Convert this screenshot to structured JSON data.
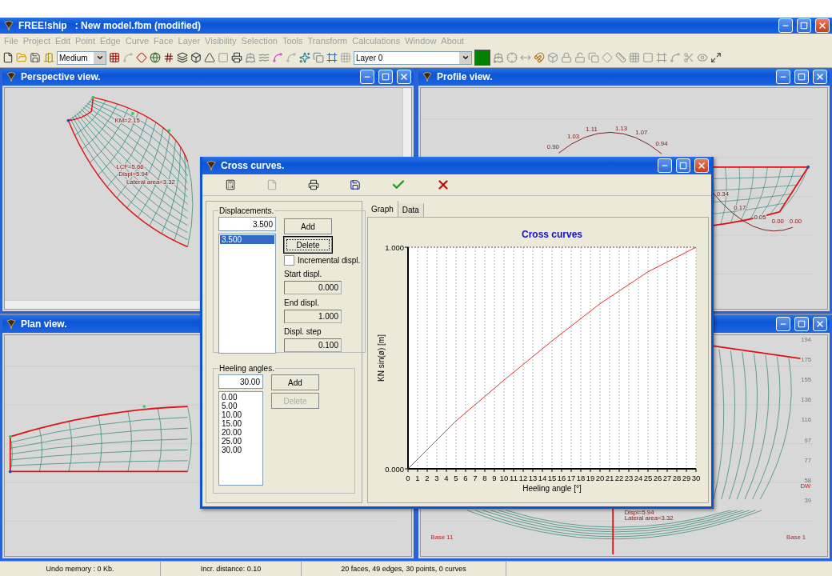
{
  "app": {
    "title": "FREE!ship   : New model.fbm (modified)"
  },
  "menu": [
    {
      "label": "File",
      "disabled": true
    },
    {
      "label": "Project",
      "disabled": true
    },
    {
      "label": "Edit",
      "disabled": true
    },
    {
      "label": "Point",
      "disabled": true
    },
    {
      "label": "Edge",
      "disabled": true
    },
    {
      "label": "Curve",
      "disabled": true
    },
    {
      "label": "Face",
      "disabled": true
    },
    {
      "label": "Layer",
      "disabled": true
    },
    {
      "label": "Visibility",
      "disabled": true
    },
    {
      "label": "Selection",
      "disabled": true
    },
    {
      "label": "Tools",
      "disabled": true
    },
    {
      "label": "Transform",
      "disabled": true
    },
    {
      "label": "Calculations",
      "disabled": true
    },
    {
      "label": "Window",
      "disabled": true
    },
    {
      "label": "About",
      "disabled": true
    }
  ],
  "toolbar": {
    "precision": "Medium",
    "layer": "Layer 0"
  },
  "views": [
    {
      "kind": "perspective",
      "title": "Perspective view.",
      "labels": [
        "KM=2.15",
        "LCF=5.66",
        "Displ=5.94",
        "Lateral area=3.32"
      ]
    },
    {
      "kind": "profile",
      "title": "Profile view.",
      "labels": [
        "0.90",
        "1.03",
        "1.11",
        "1.13",
        "1.07",
        "0.94",
        "0.34",
        "0.17",
        "0.05",
        "0.00",
        "0.00"
      ]
    },
    {
      "kind": "plan",
      "title": "Plan view."
    },
    {
      "kind": "bodyplan",
      "labels": [
        "Displ=5.94",
        "Lateral area=3.32",
        "Base 11",
        "Base 1",
        "DW"
      ],
      "scale": [
        "194",
        "175",
        "155",
        "136",
        "116",
        "97",
        "77",
        "58",
        "39"
      ]
    }
  ],
  "dialog": {
    "title": "Cross curves.",
    "displacements": {
      "title": "Displacements.",
      "input": "3.500",
      "add": {
        "label": "Add",
        "disabled": false,
        "focused": false
      },
      "delete": {
        "label": "Delete",
        "disabled": false,
        "focused": true
      },
      "items": [
        {
          "label": "3.500",
          "selected": true
        }
      ],
      "incremental": {
        "label": "Incremental displ.",
        "checked": false
      },
      "fields": [
        {
          "label": "Start displ.",
          "value": "0.000",
          "disabled": true
        },
        {
          "label": "End displ.",
          "value": "1.000",
          "disabled": true
        },
        {
          "label": "Displ. step",
          "value": "0.100",
          "disabled": true
        }
      ]
    },
    "heeling": {
      "title": "Heeling angles.",
      "input": "30.00",
      "add": {
        "label": "Add",
        "disabled": false,
        "focused": false
      },
      "delete": {
        "label": "Delete",
        "disabled": true,
        "focused": false
      },
      "items": [
        {
          "label": "0.00",
          "selected": false
        },
        {
          "label": "5.00",
          "selected": false
        },
        {
          "label": "10.00",
          "selected": false
        },
        {
          "label": "15.00",
          "selected": false
        },
        {
          "label": "20.00",
          "selected": false
        },
        {
          "label": "25.00",
          "selected": false
        },
        {
          "label": "30.00",
          "selected": false
        }
      ]
    },
    "tabs": [
      {
        "label": "Graph",
        "selected": true
      },
      {
        "label": "Data",
        "selected": false
      }
    ],
    "chart_data": {
      "type": "line",
      "title": "Cross curves",
      "xlabel": "Heeling angle [°]",
      "ylabel": "KN sin(ø) [m]",
      "x": [
        0,
        5,
        10,
        15,
        20,
        25,
        30
      ],
      "series": [
        {
          "color": "#e03030",
          "values": [
            0,
            0.216,
            0.4,
            0.577,
            0.745,
            0.889,
            1.0
          ]
        }
      ],
      "xlim": [
        0,
        30
      ],
      "ylim": [
        0,
        1
      ],
      "xticks": [
        0,
        1,
        2,
        3,
        4,
        5,
        6,
        7,
        8,
        9,
        10,
        11,
        12,
        13,
        14,
        15,
        16,
        17,
        18,
        19,
        20,
        21,
        22,
        23,
        24,
        25,
        26,
        27,
        28,
        29,
        30
      ],
      "yticks": [
        {
          "value": 0,
          "label": "0.000"
        },
        {
          "value": 1,
          "label": "1.000"
        }
      ],
      "grid": true
    }
  },
  "status_bar": [
    "Undo memory : 0 Kb.",
    "Incr. distance: 0.10",
    "20 faces, 49 edges, 30 points, 0 curves"
  ]
}
